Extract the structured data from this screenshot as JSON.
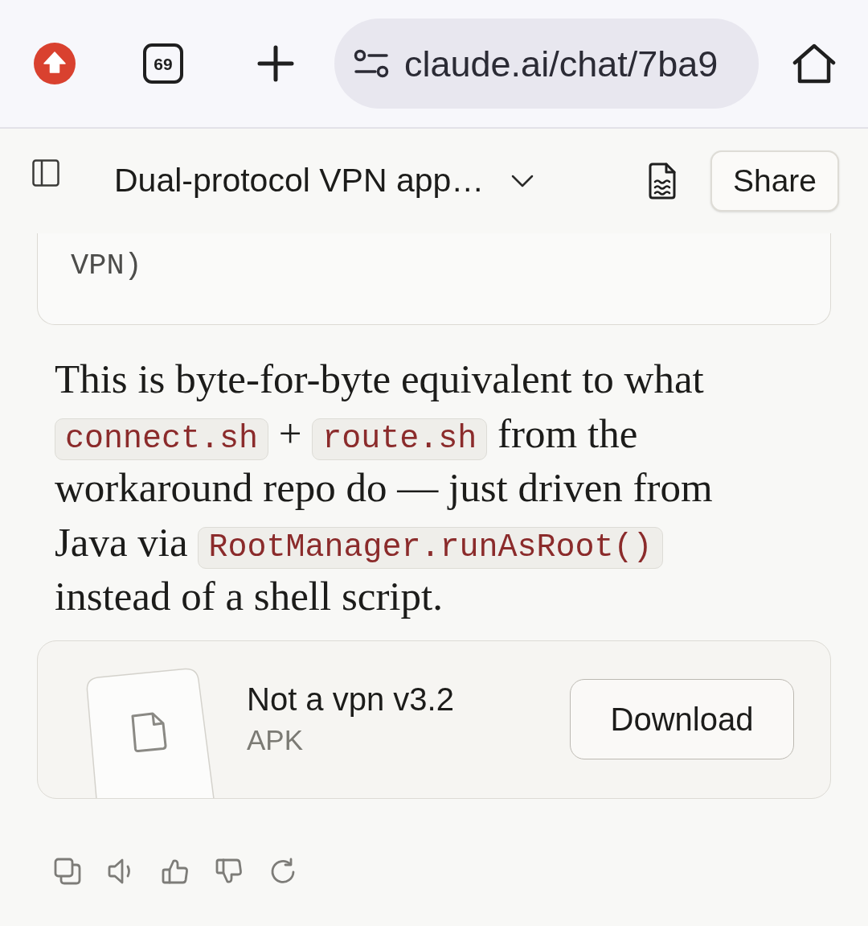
{
  "browser_bar": {
    "tab_count": "69",
    "url": "claude.ai/chat/7ba9"
  },
  "header": {
    "title": "Dual-protocol VPN app…",
    "share_button": "Share"
  },
  "code_block": {
    "text": "VPN)"
  },
  "message": {
    "segments": [
      {
        "kind": "text",
        "text": "This is byte-for-byte equivalent to what "
      },
      {
        "kind": "code",
        "text": "connect.sh"
      },
      {
        "kind": "text",
        "text": " + "
      },
      {
        "kind": "code",
        "text": "route.sh"
      },
      {
        "kind": "text",
        "text": " from the workaround repo do — just driven from Java via "
      },
      {
        "kind": "code",
        "text": "RootManager.runAsRoot()"
      },
      {
        "kind": "text",
        "text": " instead of a shell script."
      }
    ]
  },
  "attachment": {
    "name": "Not a vpn v3.2",
    "file_type": "APK",
    "download_button": "Download"
  }
}
